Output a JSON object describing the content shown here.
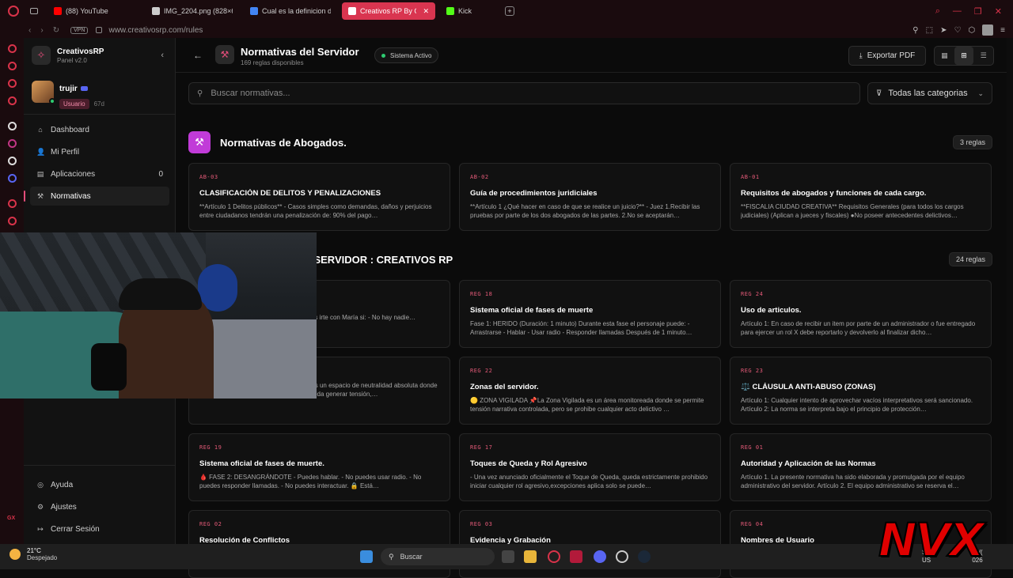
{
  "browser": {
    "tabs": [
      {
        "label": "(88) YouTube",
        "color": "#ff0000",
        "active": false
      },
      {
        "label": "IMG_2204.png (828×678)",
        "color": "#cccccc",
        "active": false
      },
      {
        "label": "Cual es la definicion de dr",
        "color": "#4285f4",
        "active": false
      },
      {
        "label": "Creativos RP By Cuxial",
        "color": "#ffffff",
        "active": true
      },
      {
        "label": "Kick",
        "color": "#53fc18",
        "active": false
      }
    ],
    "url": "www.creativosrp.com/rules",
    "vpn": "VPN"
  },
  "sidebar": {
    "brand_name": "CreativosRP",
    "brand_version": "Panel v2.0",
    "user": {
      "name": "trujir",
      "role": "Usuario",
      "days": "67d"
    },
    "items": [
      {
        "label": "Dashboard",
        "icon": "home-icon",
        "glyph": "⌂",
        "count": ""
      },
      {
        "label": "Mi Perfil",
        "icon": "user-icon",
        "glyph": "👤",
        "count": ""
      },
      {
        "label": "Aplicaciones",
        "icon": "file-icon",
        "glyph": "▤",
        "count": "0"
      },
      {
        "label": "Normativas",
        "icon": "gavel-icon",
        "glyph": "⚒",
        "count": ""
      }
    ],
    "bottom_items": [
      {
        "label": "Ayuda",
        "icon": "help-icon",
        "glyph": "◎"
      },
      {
        "label": "Ajustes",
        "icon": "gear-icon",
        "glyph": "⚙"
      },
      {
        "label": "Cerrar Sesión",
        "icon": "logout-icon",
        "glyph": "↦"
      }
    ]
  },
  "header": {
    "title": "Normativas del Servidor",
    "subtitle": "169 reglas disponibles",
    "status": "Sistema Activo",
    "export_label": "Exportar PDF"
  },
  "search": {
    "placeholder": "Buscar normativas...",
    "category": "Todas las categorias"
  },
  "sections": [
    {
      "title": "Normativas de Abogados.",
      "count": "3 reglas",
      "cards": [
        {
          "code": "AB-03",
          "title": "CLASIFICACIÓN DE DELITOS Y PENALIZACIONES",
          "desc": "**Artículo 1 Delitos públicos** - Casos simples como demandas, daños y perjuicios entre ciudadanos tendrán una penalización de: 90% del pago…"
        },
        {
          "code": "AB-02",
          "title": "Guía de procedimientos juridiciales",
          "desc": "**Artículo 1 ¿Qué hacer en caso de que se realice un juicio?** - Juez 1.Recibir las pruebas por parte de los dos abogados de las partes. 2.No se aceptarán…"
        },
        {
          "code": "AB-01",
          "title": "Requisitos de abogados y funciones de cada cargo.",
          "desc": "**FISCALIA CIUDAD CREATIVA** Requisitos Generales (para todos los cargos judiciales) (Aplican a jueces y fiscales) ●No poseer antecedentes delictivos…"
        }
      ]
    },
    {
      "title": "NORMATIVAS DEL SERVIDOR : CREATIVOS RP",
      "title_visible": "IDOR : CREATIVOS RP",
      "count": "24 reglas",
      "cards": [
        {
          "code": "",
          "title": "e.",
          "desc": "e totalmente inconsciente. - No hay uedes irte con María si: - No hay nadie…"
        },
        {
          "code": "REG 18",
          "title": "Sistema oficial de fases de muerte",
          "desc": "Fase 1: HERIDO (Duración: 1 minuto) Durante esta fase el personaje puede: - Arrastrarse - Hablar - Usar radio - Responder llamadas Después de 1 minuto…"
        },
        {
          "code": "REG 24",
          "title": "Uso de articulos.",
          "desc": "Artículo 1: En caso de recibir un item por parte de un administrador o fue entregado para ejercer un rol X debe reportarlo y devolverlo al finalizar dicho…"
        },
        {
          "code": "",
          "title": "",
          "desc": "🔵 ZONA SEGURA 📌La Zona Segura es un espacio de neutralidad absoluta donde queda prohibida cualquier acción que pueda generar tensión,…"
        },
        {
          "code": "REG 22",
          "title": "Zonas del servidor.",
          "desc": "🟡 ZONA VIGILADA 📌La Zona Vigilada es un área monitoreada donde se permite tensión narrativa controlada, pero se prohibe cualquier acto delictivo …"
        },
        {
          "code": "REG 23",
          "title": "⚖️ CLÁUSULA ANTI-ABUSO (ZONAS)",
          "desc": "Artículo 1: Cualquier intento de aprovechar vacíos interpretativos será sancionado. Artículo 2: La norma se interpreta bajo el principio de protección…"
        },
        {
          "code": "REG 19",
          "title": "Sistema oficial de fases de muerte.",
          "desc": "🩸 FASE 2: DESANGRÁNDOTE - Puedes hablar. - No puedes usar radio. - No puedes responder llamadas. - No puedes interactuar. 🔒 Está…"
        },
        {
          "code": "REG 17",
          "title": "Toques de Queda y Rol Agresivo",
          "desc": "- Una vez anunciado oficialmente el Toque de Queda, queda estrictamente prohibido iniciar cualquier rol agresivo,excepciones aplica solo se puede…"
        },
        {
          "code": "REG 01",
          "title": "Autoridad y Aplicación de las Normas",
          "desc": "Artículo 1. La presente normativa ha sido elaborada y promulgada por el equipo administrativo del servidor. Artículo 2. El equipo administrativo se reserva el…"
        },
        {
          "code": "REG 02",
          "title": "Resolución de Conflictos",
          "desc": ""
        },
        {
          "code": "REG 03",
          "title": "Evidencia y Grabación",
          "desc": ""
        },
        {
          "code": "REG 04",
          "title": "Nombres de Usuario",
          "desc": ""
        }
      ]
    }
  ],
  "taskbar": {
    "temp": "21°C",
    "weather": "Despejado",
    "search": "Buscar",
    "tray_lang": "SP",
    "tray_region": "US",
    "tray_date": "31/(",
    "tray_year": "026"
  },
  "overlay": {
    "watermark": "NVX",
    "rail_label": "GX"
  },
  "colors": {
    "accent": "#e34d7a",
    "browser_accent": "#d93550",
    "section_icon": "#c13bd8",
    "status_ok": "#2ecc71"
  }
}
